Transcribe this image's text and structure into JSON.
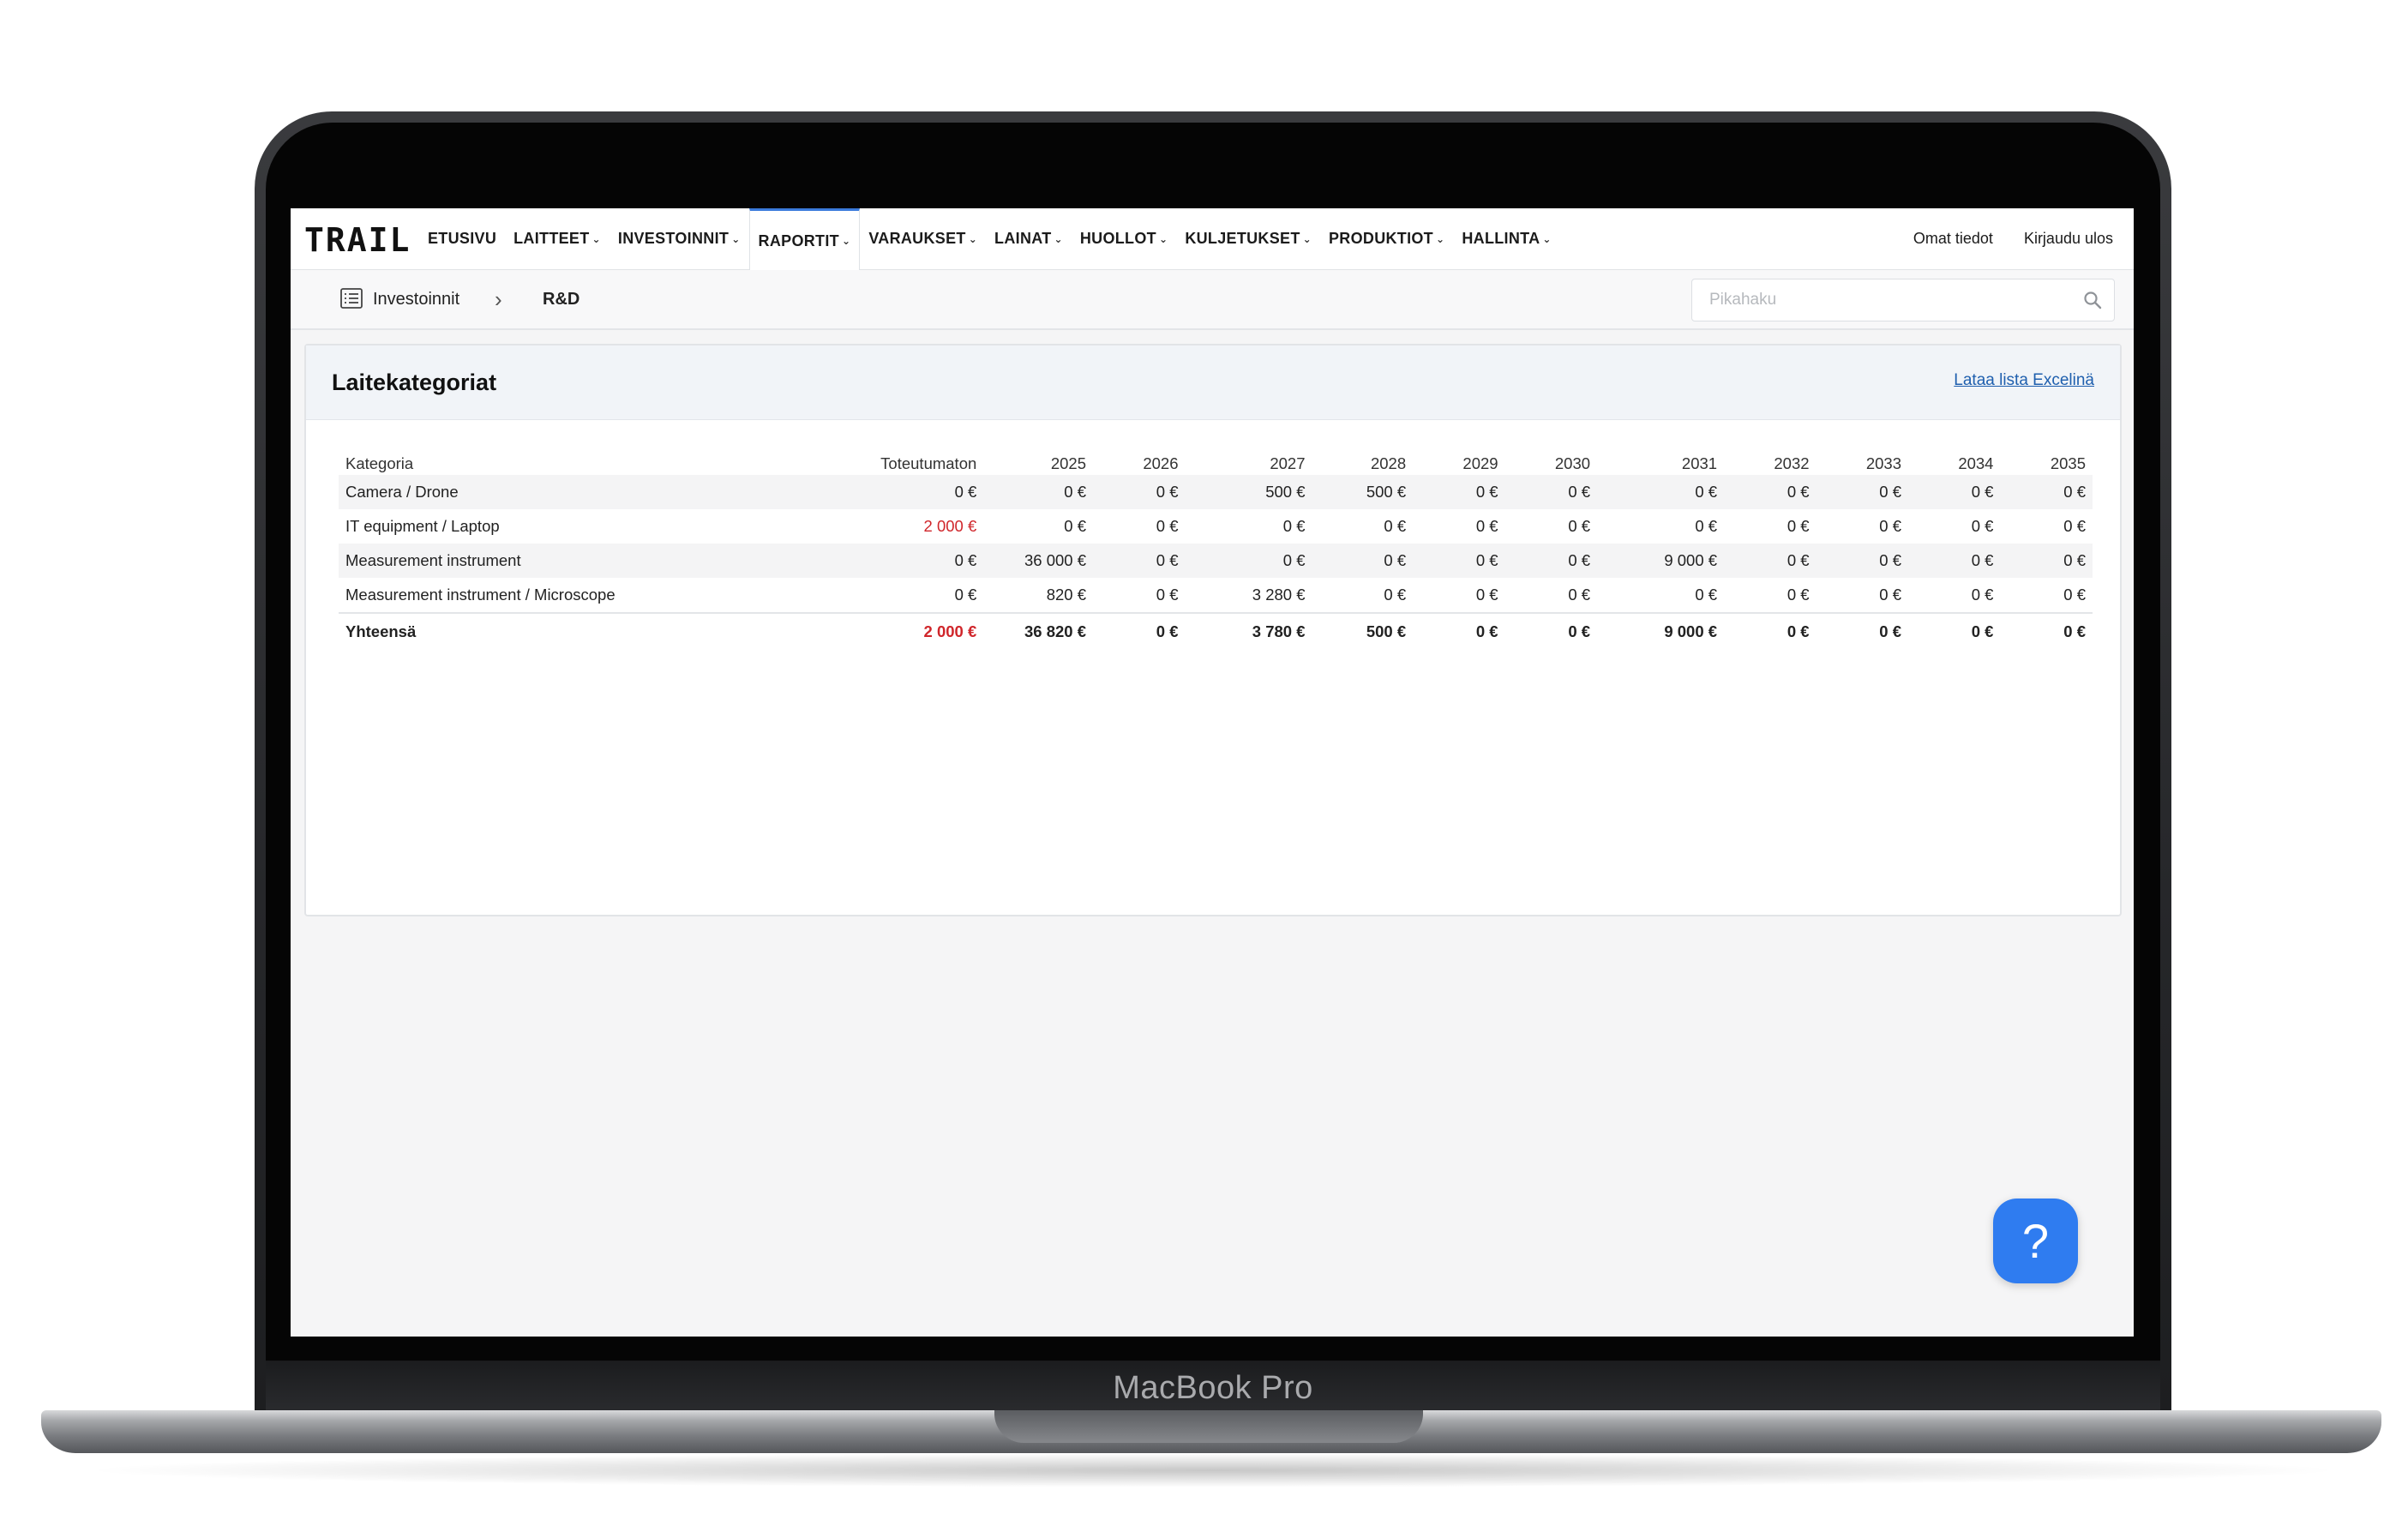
{
  "device": {
    "brand": "MacBook Pro"
  },
  "app": {
    "logo": "TRAIL"
  },
  "nav": {
    "items": [
      {
        "label": "ETUSIVU",
        "dropdown": false,
        "active": false
      },
      {
        "label": "LAITTEET",
        "dropdown": true,
        "active": false
      },
      {
        "label": "INVESTOINNIT",
        "dropdown": true,
        "active": false
      },
      {
        "label": "RAPORTIT",
        "dropdown": true,
        "active": true
      },
      {
        "label": "VARAUKSET",
        "dropdown": true,
        "active": false
      },
      {
        "label": "LAINAT",
        "dropdown": true,
        "active": false
      },
      {
        "label": "HUOLLOT",
        "dropdown": true,
        "active": false
      },
      {
        "label": "KULJETUKSET",
        "dropdown": true,
        "active": false
      },
      {
        "label": "PRODUKTIOT",
        "dropdown": true,
        "active": false
      },
      {
        "label": "HALLINTA",
        "dropdown": true,
        "active": false
      }
    ],
    "profile": "Omat tiedot",
    "logout": "Kirjaudu ulos",
    "accent_color": "#3b7bdc"
  },
  "breadcrumb": {
    "root": "Investoinnit",
    "separator": "›",
    "current": "R&D",
    "icon": "list-icon"
  },
  "search": {
    "placeholder": "Pikahaku",
    "icon": "search-icon"
  },
  "panel": {
    "title": "Laitekategoriat",
    "excel_link": "Lataa lista Excelinä",
    "table": {
      "headers": [
        "Kategoria",
        "Toteutumaton",
        "2025",
        "2026",
        "2027",
        "2028",
        "2029",
        "2030",
        "2031",
        "2032",
        "2033",
        "2034",
        "2035"
      ],
      "rows": [
        [
          "Camera / Drone",
          "0 €",
          "0 €",
          "0 €",
          "500 €",
          "500 €",
          "0 €",
          "0 €",
          "0 €",
          "0 €",
          "0 €",
          "0 €",
          "0 €"
        ],
        [
          "IT equipment / Laptop",
          "2 000 €",
          "0 €",
          "0 €",
          "0 €",
          "0 €",
          "0 €",
          "0 €",
          "0 €",
          "0 €",
          "0 €",
          "0 €",
          "0 €"
        ],
        [
          "Measurement instrument",
          "0 €",
          "36 000 €",
          "0 €",
          "0 €",
          "0 €",
          "0 €",
          "0 €",
          "9 000 €",
          "0 €",
          "0 €",
          "0 €",
          "0 €"
        ],
        [
          "Measurement instrument / Microscope",
          "0 €",
          "820 €",
          "0 €",
          "3 280 €",
          "0 €",
          "0 €",
          "0 €",
          "0 €",
          "0 €",
          "0 €",
          "0 €",
          "0 €"
        ]
      ],
      "total": [
        "Yhteensä",
        "2 000 €",
        "36 820 €",
        "0 €",
        "3 780 €",
        "500 €",
        "0 €",
        "0 €",
        "9 000 €",
        "0 €",
        "0 €",
        "0 €",
        "0 €"
      ],
      "highlight_color": "#d0262b"
    }
  },
  "help": {
    "label": "?",
    "color": "#2f7cf0"
  }
}
